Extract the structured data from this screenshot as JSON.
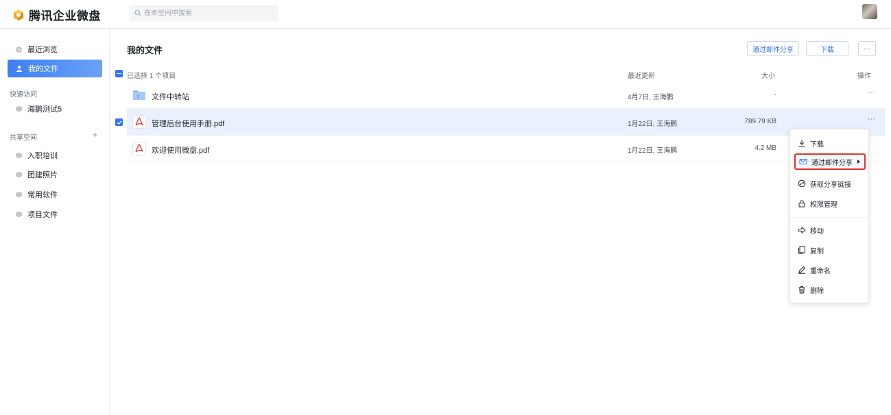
{
  "app": {
    "name": "腾讯企业微盘"
  },
  "search": {
    "placeholder": "在本空间中搜索"
  },
  "sidebar": {
    "items": [
      {
        "label": "最近浏览"
      },
      {
        "label": "我的文件"
      }
    ],
    "quick_access": {
      "title": "快速访问",
      "items": [
        {
          "label": "海鹏测试5"
        }
      ]
    },
    "shared": {
      "title": "共享空间",
      "add_label": "+",
      "items": [
        {
          "label": "入职培训"
        },
        {
          "label": "团建照片"
        },
        {
          "label": "常用软件"
        },
        {
          "label": "项目文件"
        }
      ]
    }
  },
  "main": {
    "title": "我的文件",
    "buttons": {
      "share_email": "通过邮件分享",
      "download": "下载",
      "more": "···"
    },
    "header": {
      "selected": "已选择 1 个项目",
      "updated": "最近更新",
      "size": "大小",
      "ops": "操作"
    },
    "rows": [
      {
        "name": "文件中转站",
        "updated": "4月7日, 王海鹏",
        "size": "-",
        "ops": "···",
        "type": "folder"
      },
      {
        "name": "管理后台使用手册.pdf",
        "updated": "1月22日, 王海鹏",
        "size": "789.79 KB",
        "ops": "···",
        "type": "pdf"
      },
      {
        "name": "欢迎使用微盘.pdf",
        "updated": "1月22日, 王海鹏",
        "size": "4.2 MB",
        "ops": "",
        "type": "pdf"
      }
    ]
  },
  "context_menu": {
    "items": [
      {
        "label": "下载"
      },
      {
        "label": "通过邮件分享"
      },
      {
        "label": "获取分享链接"
      },
      {
        "label": "权限管理"
      },
      {
        "label": "移动"
      },
      {
        "label": "复制"
      },
      {
        "label": "重命名"
      },
      {
        "label": "删除"
      }
    ]
  },
  "colors": {
    "accent": "#3370ff",
    "highlight_border": "#e0342b",
    "pdf_red": "#e0342b"
  }
}
